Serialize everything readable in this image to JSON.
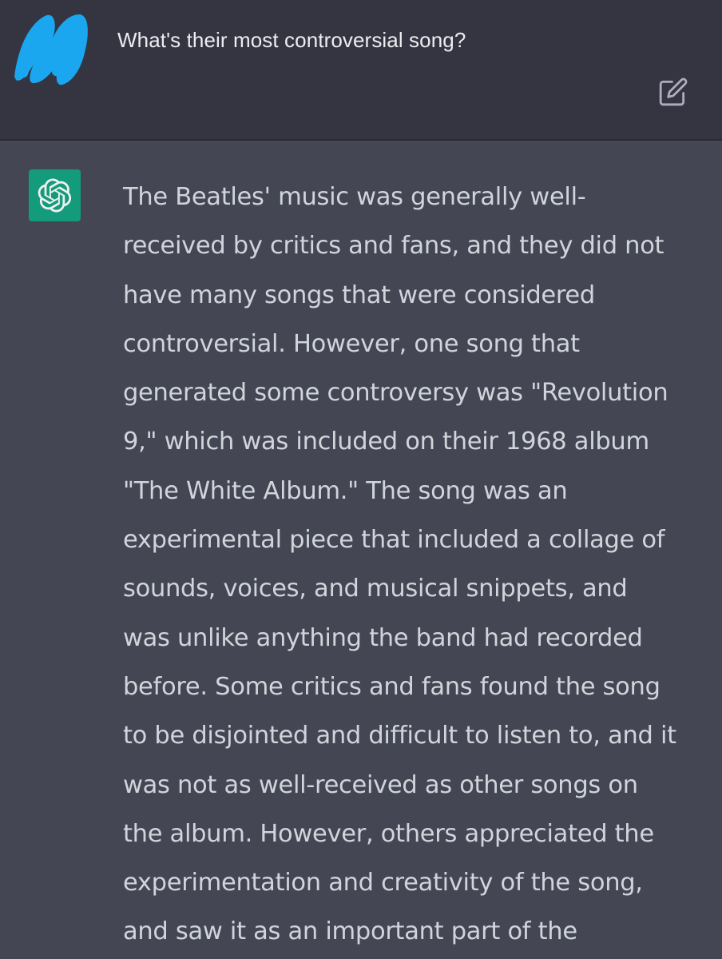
{
  "user": {
    "avatar": "scribbled-out-avatar",
    "message": "What's their most controversial song?",
    "edit_icon": "edit-icon"
  },
  "assistant": {
    "avatar": "openai-logo-icon",
    "avatar_color": "#10a37f",
    "lines": [
      "The Beatles' music was generally well-",
      "received by critics and fans, and they did not",
      "have many songs that were considered",
      "controversial. However, one song that",
      "generated some controversy was \"Revolution",
      "9,\" which was included on their 1968 album",
      "\"The White Album.\" The song was an",
      "experimental piece that included a collage of",
      "sounds, voices, and musical snippets, and",
      "was unlike anything the band had recorded",
      "before. Some critics and fans found the song",
      "to be disjointed and difficult to listen to, and it",
      "was not as well-received as other songs on",
      "the album. However, others appreciated the",
      "experimentation and creativity of the song,",
      "and saw it as an important part of the"
    ]
  },
  "colors": {
    "user_background": "#343541",
    "assistant_background": "#444654",
    "scribble": "#1aa7f0"
  }
}
